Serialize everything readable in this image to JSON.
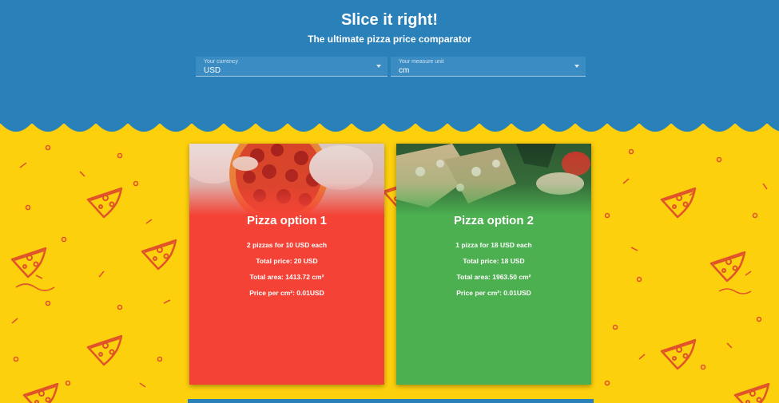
{
  "header": {
    "title": "Slice it right!",
    "subtitle": "The ultimate pizza price comparator"
  },
  "currency_select": {
    "label": "Your currency",
    "value": "USD"
  },
  "unit_select": {
    "label": "Your measure unit",
    "value": "cm"
  },
  "options": [
    {
      "title": "Pizza option 1",
      "summary": "2 pizzas for 10 USD each",
      "total_price": "Total price:  20 USD",
      "total_area": "Total area:  1413.72 cm²",
      "price_per_area": "Price per cm²:  0.01USD",
      "color": "#f44336"
    },
    {
      "title": "Pizza option 2",
      "summary": "1 pizza for 18 USD each",
      "total_price": "Total price:  18 USD",
      "total_area": "Total area:  1963.50 cm²",
      "price_per_area": "Price per cm²:  0.01USD",
      "color": "#4caf50"
    }
  ],
  "colors": {
    "header": "#2a80b9",
    "background": "#fdd00e",
    "pattern": "#e0532a"
  }
}
